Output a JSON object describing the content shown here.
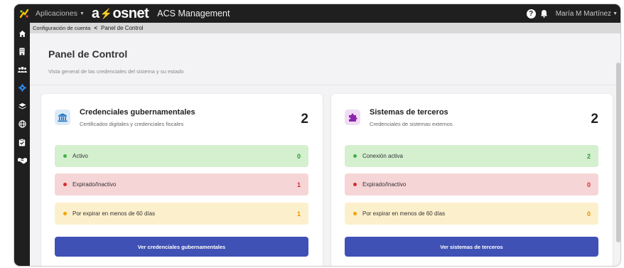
{
  "topbar": {
    "apps_label": "Aplicaciones",
    "brand": {
      "left": "a",
      "right": "osnet"
    },
    "app_title": "ACS Management",
    "user_name": "María M Martínez"
  },
  "sidebar": {
    "items": [
      {
        "name": "home-icon",
        "active": false
      },
      {
        "name": "building-icon",
        "active": false
      },
      {
        "name": "users-icon",
        "active": false
      },
      {
        "name": "settings-icon",
        "active": true
      },
      {
        "name": "layers-icon",
        "active": false
      },
      {
        "name": "globe-icon",
        "active": false
      },
      {
        "name": "clipboard-check-icon",
        "active": false
      },
      {
        "name": "handshake-icon",
        "active": false
      }
    ]
  },
  "breadcrumb": {
    "parent": "Configuración de cuenta",
    "separator": "<",
    "current": "Panel de Control"
  },
  "page": {
    "title": "Panel de Control",
    "subtitle": "Vista general de las credenciales del sistema y su estado"
  },
  "cards": {
    "government": {
      "title": "Credenciales gubernamentales",
      "subtitle": "Certificados digitales y credenciales fiscales",
      "count": "2",
      "icon": "bank-icon",
      "icon_color": "#1e73be",
      "icon_bg": "#dceaf8",
      "stats": [
        {
          "label": "Activo",
          "value": "0",
          "dot": "#43b048",
          "value_color": "#2e9a35"
        },
        {
          "label": "Expirado/Inactivo",
          "value": "1",
          "dot": "#d32f2f",
          "value_color": "#d32f2f"
        },
        {
          "label": "Por expirar en menos de 60 días",
          "value": "1",
          "dot": "#f5a300",
          "value_color": "#f08c00"
        }
      ],
      "button_label": "Ver credenciales gubernamentales"
    },
    "third_party": {
      "title": "Sistemas de terceros",
      "subtitle": "Credenciales de sistemas externos",
      "count": "2",
      "icon": "puzzle-icon",
      "icon_color": "#8e24aa",
      "icon_bg": "#f0dcf4",
      "stats": [
        {
          "label": "Conexión activa",
          "value": "2",
          "dot": "#43b048",
          "value_color": "#2e9a35"
        },
        {
          "label": "Expirado/Inactivo",
          "value": "0",
          "dot": "#d32f2f",
          "value_color": "#d32f2f"
        },
        {
          "label": "Por expirar en menos de 60 días",
          "value": "0",
          "dot": "#f5a300",
          "value_color": "#f08c00"
        }
      ],
      "button_label": "Ver sistemas de terceros"
    }
  },
  "colors": {
    "topbar_bg": "#1f1f1f",
    "accent_blue": "#2f8cf0",
    "button_bg": "#3f51b5",
    "brand_bolt": "#f5c400"
  }
}
